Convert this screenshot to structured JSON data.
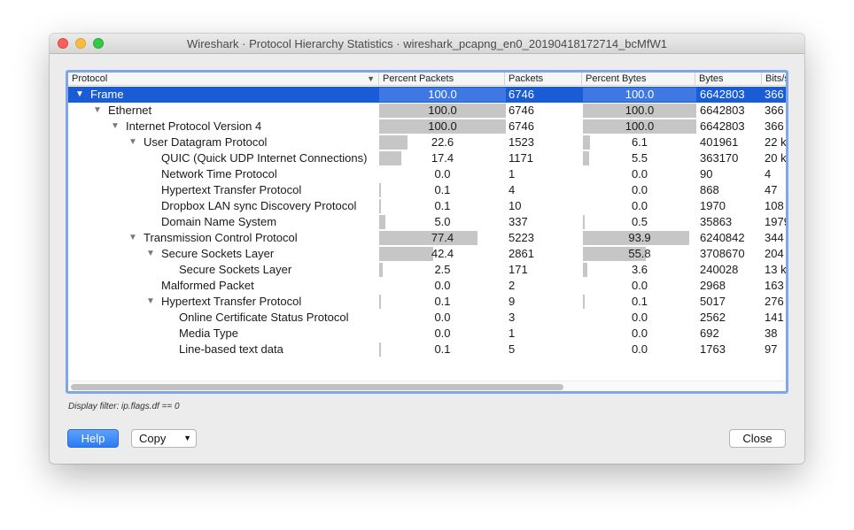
{
  "window": {
    "title": "Wireshark · Protocol Hierarchy Statistics · wireshark_pcapng_en0_20190418172714_bcMfW1"
  },
  "columns": [
    "Protocol",
    "Percent Packets",
    "Packets",
    "Percent Bytes",
    "Bytes",
    "Bits/s"
  ],
  "rows": [
    {
      "protocol": "Frame",
      "depth": 0,
      "expanded": true,
      "selected": true,
      "percent_packets": "100.0",
      "packets": "6746",
      "percent_bytes": "100.0",
      "bytes": "6642803",
      "bits": "366"
    },
    {
      "protocol": "Ethernet",
      "depth": 1,
      "expanded": true,
      "percent_packets": "100.0",
      "packets": "6746",
      "percent_bytes": "100.0",
      "bytes": "6642803",
      "bits": "366"
    },
    {
      "protocol": "Internet Protocol Version 4",
      "depth": 2,
      "expanded": true,
      "percent_packets": "100.0",
      "packets": "6746",
      "percent_bytes": "100.0",
      "bytes": "6642803",
      "bits": "366"
    },
    {
      "protocol": "User Datagram Protocol",
      "depth": 3,
      "expanded": true,
      "percent_packets": "22.6",
      "packets": "1523",
      "percent_bytes": "6.1",
      "bytes": "401961",
      "bits": "22 k"
    },
    {
      "protocol": "QUIC (Quick UDP Internet Connections)",
      "depth": 4,
      "percent_packets": "17.4",
      "packets": "1171",
      "percent_bytes": "5.5",
      "bytes": "363170",
      "bits": "20 k"
    },
    {
      "protocol": "Network Time Protocol",
      "depth": 4,
      "percent_packets": "0.0",
      "packets": "1",
      "percent_bytes": "0.0",
      "bytes": "90",
      "bits": "4"
    },
    {
      "protocol": "Hypertext Transfer Protocol",
      "depth": 4,
      "percent_packets": "0.1",
      "packets": "4",
      "percent_bytes": "0.0",
      "bytes": "868",
      "bits": "47"
    },
    {
      "protocol": "Dropbox LAN sync Discovery Protocol",
      "depth": 4,
      "percent_packets": "0.1",
      "packets": "10",
      "percent_bytes": "0.0",
      "bytes": "1970",
      "bits": "108"
    },
    {
      "protocol": "Domain Name System",
      "depth": 4,
      "percent_packets": "5.0",
      "packets": "337",
      "percent_bytes": "0.5",
      "bytes": "35863",
      "bits": "1979"
    },
    {
      "protocol": "Transmission Control Protocol",
      "depth": 3,
      "expanded": true,
      "percent_packets": "77.4",
      "packets": "5223",
      "percent_bytes": "93.9",
      "bytes": "6240842",
      "bits": "344"
    },
    {
      "protocol": "Secure Sockets Layer",
      "depth": 4,
      "expanded": true,
      "percent_packets": "42.4",
      "packets": "2861",
      "percent_bytes": "55.8",
      "bytes": "3708670",
      "bits": "204"
    },
    {
      "protocol": "Secure Sockets Layer",
      "depth": 5,
      "percent_packets": "2.5",
      "packets": "171",
      "percent_bytes": "3.6",
      "bytes": "240028",
      "bits": "13 k"
    },
    {
      "protocol": "Malformed Packet",
      "depth": 4,
      "percent_packets": "0.0",
      "packets": "2",
      "percent_bytes": "0.0",
      "bytes": "2968",
      "bits": "163"
    },
    {
      "protocol": "Hypertext Transfer Protocol",
      "depth": 4,
      "expanded": true,
      "percent_packets": "0.1",
      "packets": "9",
      "percent_bytes": "0.1",
      "bytes": "5017",
      "bits": "276"
    },
    {
      "protocol": "Online Certificate Status Protocol",
      "depth": 5,
      "percent_packets": "0.0",
      "packets": "3",
      "percent_bytes": "0.0",
      "bytes": "2562",
      "bits": "141"
    },
    {
      "protocol": "Media Type",
      "depth": 5,
      "percent_packets": "0.0",
      "packets": "1",
      "percent_bytes": "0.0",
      "bytes": "692",
      "bits": "38"
    },
    {
      "protocol": "Line-based text data",
      "depth": 5,
      "percent_packets": "0.1",
      "packets": "5",
      "percent_bytes": "0.0",
      "bytes": "1763",
      "bits": "97"
    }
  ],
  "display_filter": "Display filter: ip.flags.df == 0",
  "buttons": {
    "help": "Help",
    "copy": "Copy",
    "close": "Close"
  },
  "icons": {
    "expanded": "triangle-down-icon",
    "sort": "sort-descending-icon",
    "dropdown": "chevron-down-icon"
  },
  "colors": {
    "selection": "#1a5bd6",
    "focus_ring": "#7fa6e8",
    "bar": "#c6c6c6",
    "help_button": "#2a7bf4"
  }
}
